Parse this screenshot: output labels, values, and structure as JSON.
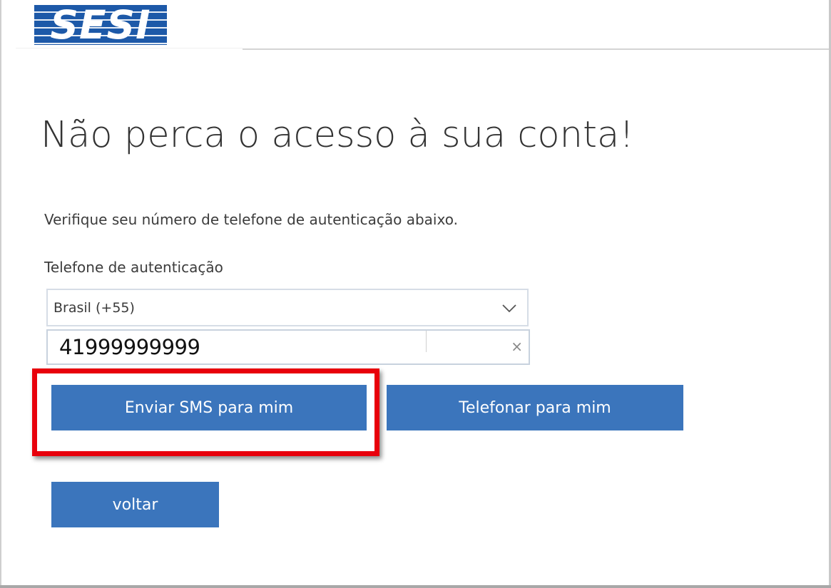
{
  "brand": {
    "logo_text": "SESI",
    "color": "#1d59a8"
  },
  "page": {
    "title": "Não perca o acesso à sua conta!",
    "instruction": "Verifique seu número de telefone de autenticação abaixo."
  },
  "form": {
    "phone_label": "Telefone de autenticação",
    "country_value": "Brasil (+55)",
    "phone_value": "41999999999",
    "clear_symbol": "×"
  },
  "buttons": {
    "sms_label": "Enviar SMS para mim",
    "call_label": "Telefonar para mim",
    "back_label": "voltar",
    "color": "#3b75bc"
  },
  "annotation": {
    "highlight_color": "#e8000c"
  },
  "icons": {
    "select_chevron": "chevron-down-icon",
    "clear": "close-icon"
  }
}
